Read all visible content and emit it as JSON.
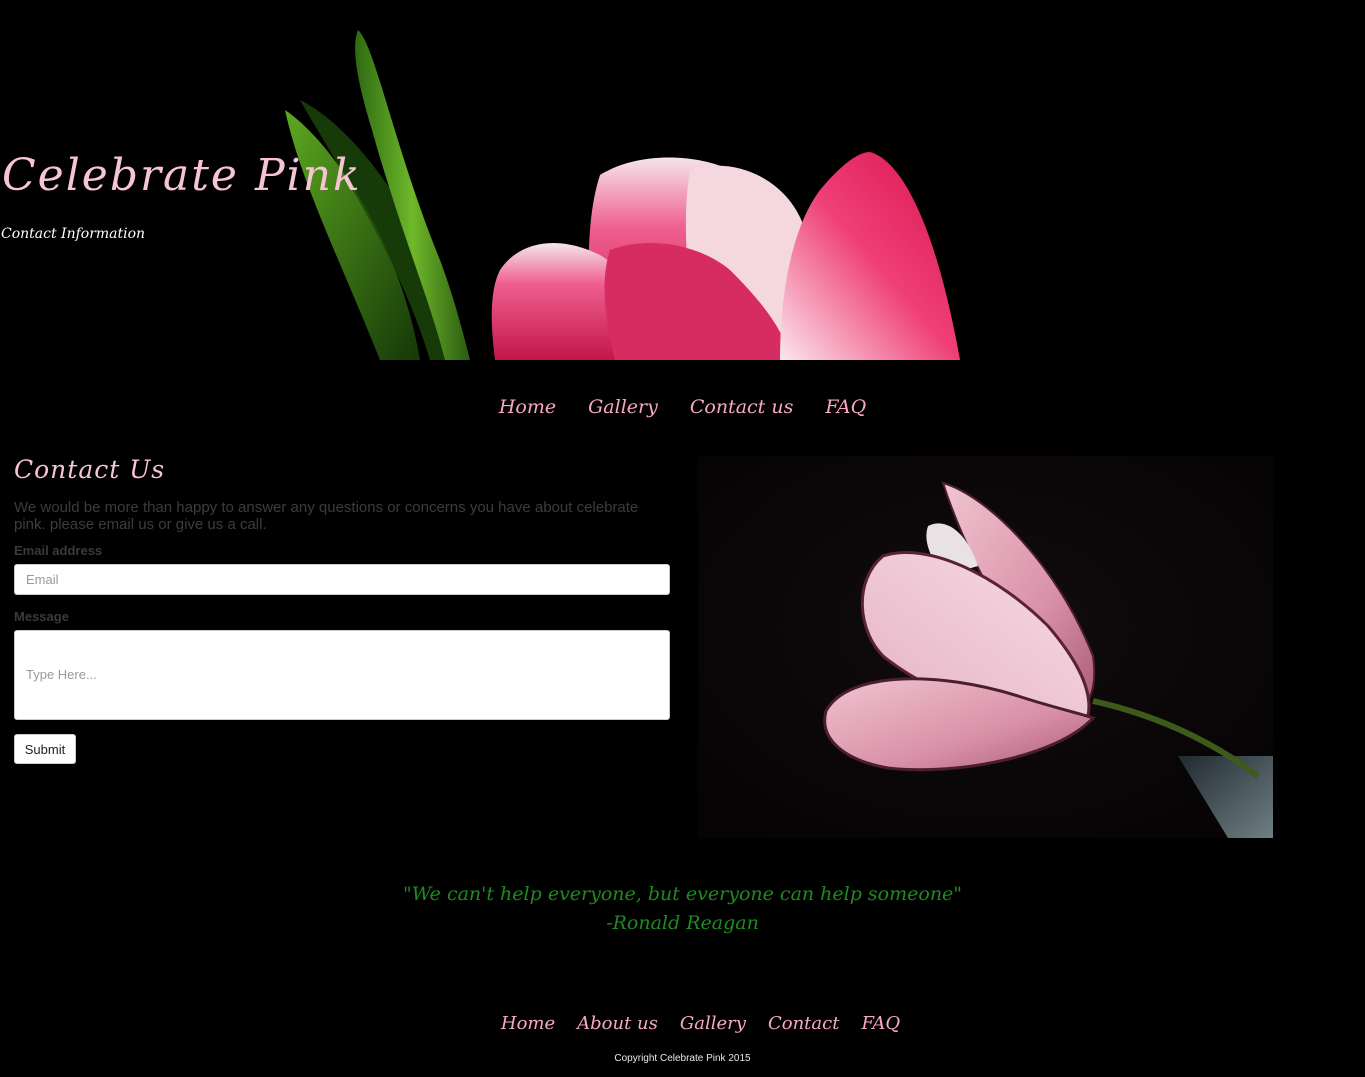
{
  "header": {
    "title": "Celebrate Pink",
    "subtitle": "Contact Information"
  },
  "nav": {
    "items": [
      {
        "label": "Home"
      },
      {
        "label": "Gallery"
      },
      {
        "label": "Contact us"
      },
      {
        "label": "FAQ"
      }
    ]
  },
  "contact": {
    "heading": "Contact Us",
    "intro": "We would be more than happy to answer any questions or concerns you have about celebrate pink. please email us or give us a call.",
    "email_label": "Email address",
    "email_placeholder": "Email",
    "message_label": "Message",
    "message_placeholder": "Type Here...",
    "submit_label": "Submit"
  },
  "quote": {
    "text": "\"We can't help everyone, but everyone can help someone\"",
    "author": "-Ronald Reagan"
  },
  "footer": {
    "items": [
      {
        "label": "Home"
      },
      {
        "label": "About us"
      },
      {
        "label": "Gallery"
      },
      {
        "label": "Contact"
      },
      {
        "label": "FAQ"
      }
    ],
    "copyright": "Copyright Celebrate Pink 2015"
  },
  "colors": {
    "background": "#000000",
    "accent_pink": "#f7a8c6",
    "quote_green": "#1f8b1f"
  },
  "icons": {
    "hero_image": "pink-tulip-hero-image",
    "side_image": "pink-tulip-photo"
  }
}
